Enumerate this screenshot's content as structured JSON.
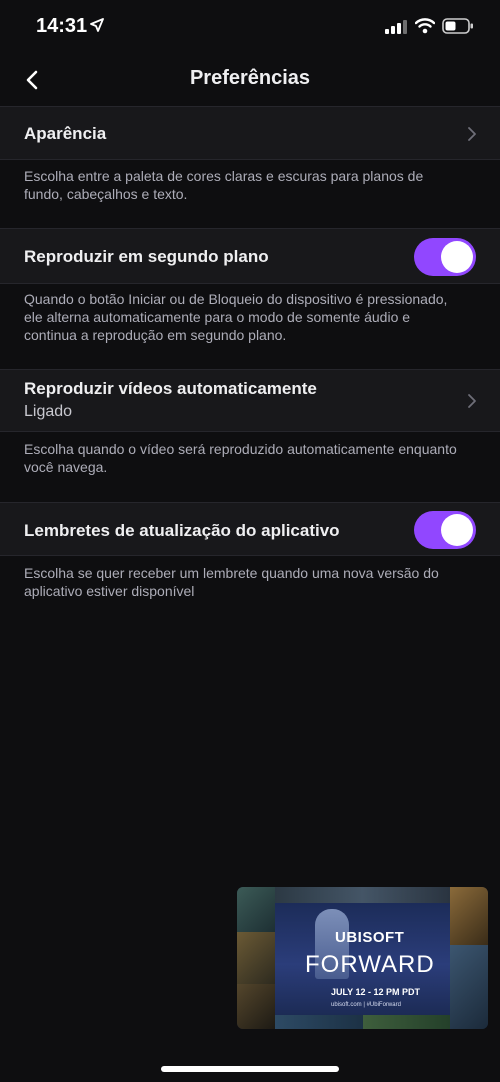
{
  "status_bar": {
    "time": "14:31",
    "icons": [
      "location-arrow-icon",
      "cellular-signal-icon",
      "wifi-icon",
      "battery-icon"
    ]
  },
  "nav": {
    "title": "Preferências",
    "back_icon": "chevron-left-icon"
  },
  "settings": {
    "appearance": {
      "label": "Aparência",
      "description": "Escolha entre a paleta de cores claras e escuras para planos de fundo, cabeçalhos e texto."
    },
    "background_play": {
      "label": "Reproduzir em segundo plano",
      "enabled": true,
      "description": "Quando o botão Iniciar ou de Bloqueio do dispositivo é pressionado, ele alterna automaticamente para o modo de somente áudio e continua a reprodução em segundo plano."
    },
    "autoplay": {
      "label": "Reproduzir vídeos automaticamente",
      "value": "Ligado",
      "description": "Escolha quando o vídeo será reproduzido automaticamente enquanto você navega."
    },
    "update_reminders": {
      "label": "Lembretes de atualização do aplicativo",
      "enabled": true,
      "description": "Escolha se quer receber um lembrete quando uma nova versão do aplicativo estiver disponível"
    }
  },
  "mini_player": {
    "brand": "UBISOFT",
    "event": "FORWARD",
    "date": "JULY 12 - 12 PM PDT",
    "url": "ubisoft.com | #UbiForward"
  },
  "colors": {
    "accent": "#9147ff",
    "background": "#0e0e10",
    "row_background": "#18181b"
  }
}
